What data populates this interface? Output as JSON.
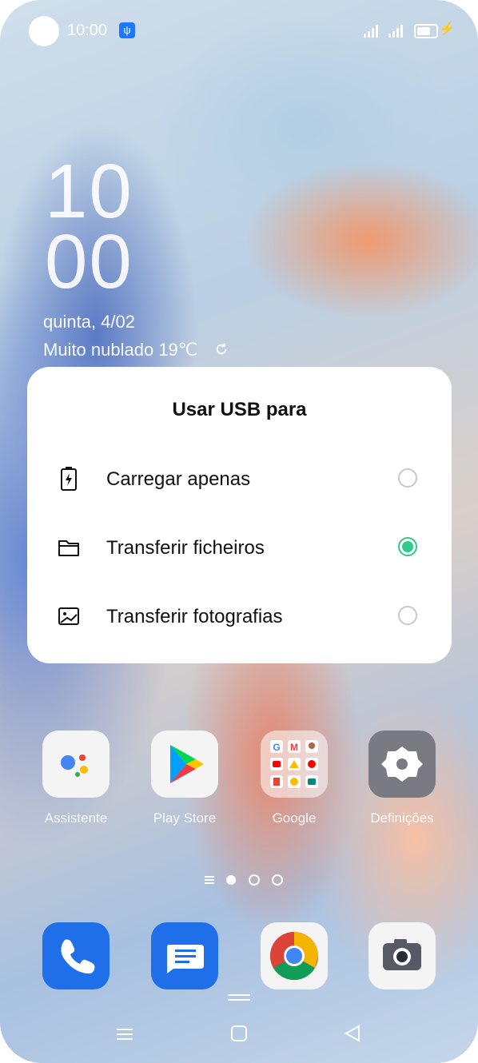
{
  "status_bar": {
    "time": "10:00",
    "usb_icon": "usb-icon",
    "battery": "charging"
  },
  "lockscreen": {
    "clock_hours": "10",
    "clock_minutes": "00",
    "date": "quinta, 4/02",
    "weather": "Muito nublado 19℃"
  },
  "dialog": {
    "title": "Usar USB para",
    "options": [
      {
        "label": "Carregar apenas",
        "icon": "battery-charge-icon",
        "selected": false
      },
      {
        "label": "Transferir ficheiros",
        "icon": "folder-icon",
        "selected": true
      },
      {
        "label": "Transferir fotografias",
        "icon": "image-icon",
        "selected": false
      }
    ],
    "selected_color": "#2ecc84"
  },
  "home": {
    "apps": [
      {
        "label": "Assistente",
        "icon": "assistant-icon"
      },
      {
        "label": "Play Store",
        "icon": "play-store-icon"
      },
      {
        "label": "Google",
        "icon": "google-folder-icon"
      },
      {
        "label": "Definições",
        "icon": "settings-gear-icon"
      }
    ],
    "dock": [
      {
        "icon": "phone-icon"
      },
      {
        "icon": "messages-icon"
      },
      {
        "icon": "chrome-icon"
      },
      {
        "icon": "camera-icon"
      }
    ],
    "page_indicator": {
      "pages": 2,
      "current": 1
    }
  }
}
